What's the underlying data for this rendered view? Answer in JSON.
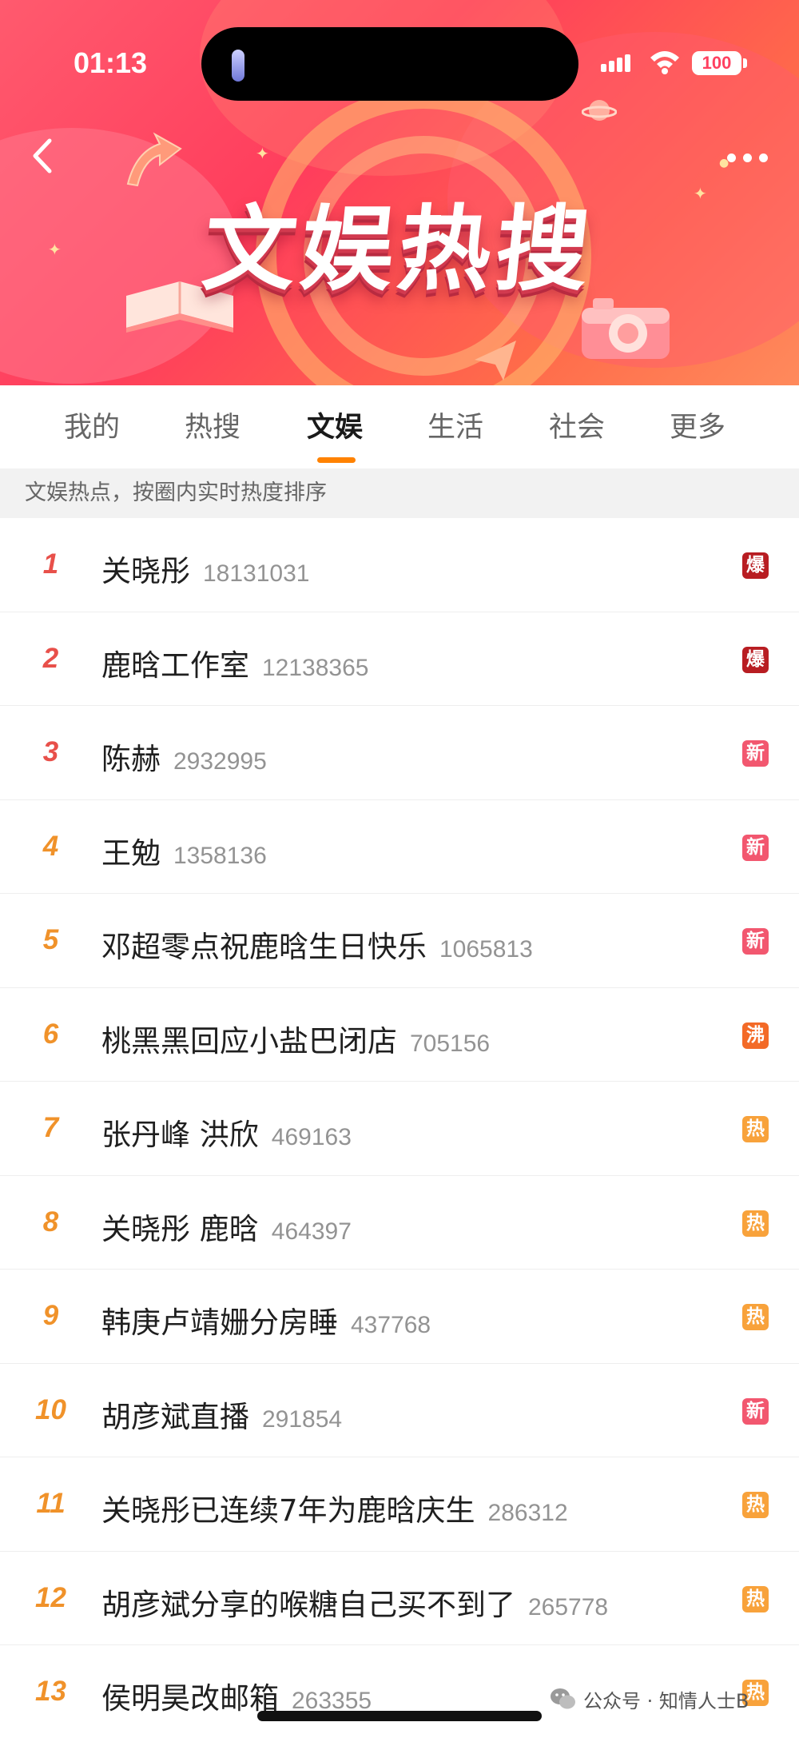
{
  "status_bar": {
    "time": "01:13",
    "battery": "100"
  },
  "header": {
    "title": "文娱热搜",
    "back_icon": "chevron-left-icon",
    "more_icon": "more-dots-icon"
  },
  "tabs": [
    {
      "label": "我的",
      "active": false
    },
    {
      "label": "热搜",
      "active": false
    },
    {
      "label": "文娱",
      "active": true
    },
    {
      "label": "生活",
      "active": false
    },
    {
      "label": "社会",
      "active": false
    },
    {
      "label": "更多",
      "active": false
    }
  ],
  "subheader": "文娱热点，按圈内实时热度排序",
  "colors": {
    "accent": "#ff8200",
    "rank_top3": "#e8504a",
    "rank_rest": "#f0922a",
    "badge_bao": "#b81d22",
    "badge_xin": "#f2576f",
    "badge_fei": "#f36a27",
    "badge_re": "#f8a23b"
  },
  "items": [
    {
      "rank": "1",
      "topic": "关晓彤",
      "count": "18131031",
      "badge": "爆",
      "badge_type": "bao"
    },
    {
      "rank": "2",
      "topic": "鹿晗工作室",
      "count": "12138365",
      "badge": "爆",
      "badge_type": "bao"
    },
    {
      "rank": "3",
      "topic": "陈赫",
      "count": "2932995",
      "badge": "新",
      "badge_type": "xin"
    },
    {
      "rank": "4",
      "topic": "王勉",
      "count": "1358136",
      "badge": "新",
      "badge_type": "xin"
    },
    {
      "rank": "5",
      "topic": "邓超零点祝鹿晗生日快乐",
      "count": "1065813",
      "badge": "新",
      "badge_type": "xin"
    },
    {
      "rank": "6",
      "topic": "桃黑黑回应小盐巴闭店",
      "count": "705156",
      "badge": "沸",
      "badge_type": "fei"
    },
    {
      "rank": "7",
      "topic": "张丹峰 洪欣",
      "count": "469163",
      "badge": "热",
      "badge_type": "re"
    },
    {
      "rank": "8",
      "topic": "关晓彤 鹿晗",
      "count": "464397",
      "badge": "热",
      "badge_type": "re"
    },
    {
      "rank": "9",
      "topic": "韩庚卢靖姗分房睡",
      "count": "437768",
      "badge": "热",
      "badge_type": "re"
    },
    {
      "rank": "10",
      "topic": "胡彦斌直播",
      "count": "291854",
      "badge": "新",
      "badge_type": "xin"
    },
    {
      "rank": "11",
      "topic": "关晓彤已连续7年为鹿晗庆生",
      "count": "286312",
      "badge": "热",
      "badge_type": "re"
    },
    {
      "rank": "12",
      "topic": "胡彦斌分享的喉糖自己买不到了",
      "count": "265778",
      "badge": "热",
      "badge_type": "re"
    },
    {
      "rank": "13",
      "topic": "侯明昊改邮箱",
      "count": "263355",
      "badge": "热",
      "badge_type": "re"
    }
  ],
  "watermark": "公众号 · 知情人士B"
}
